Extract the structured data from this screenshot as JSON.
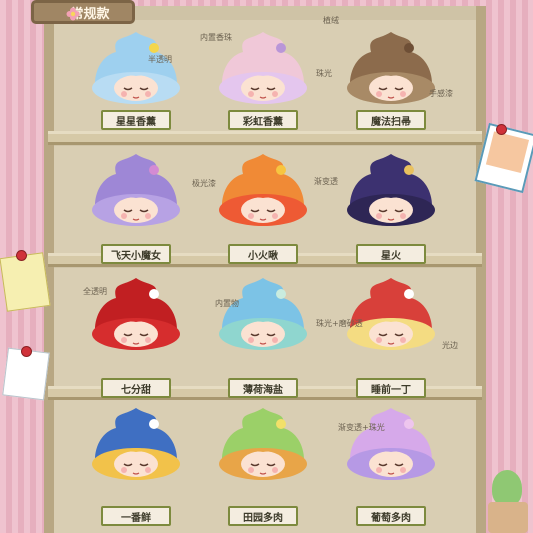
{
  "title": {
    "text": "常规款"
  },
  "items": [
    {
      "name": "星星香薰",
      "hair": "#b8dcf3",
      "body": "#9ed0ef",
      "accent": "#f4d64c"
    },
    {
      "name": "彩虹香薰",
      "hair": "#e4c6ee",
      "body": "#f0c8d8",
      "accent": "#b996d8"
    },
    {
      "name": "魔法扫帚",
      "hair": "#a88a66",
      "body": "#8c6b4c",
      "accent": "#6e4f36"
    },
    {
      "name": "飞天小魔女",
      "hair": "#b7a2e4",
      "body": "#9e87d6",
      "accent": "#d38bd3"
    },
    {
      "name": "小火啾",
      "hair": "#ee5a34",
      "body": "#f08a36",
      "accent": "#f7c540"
    },
    {
      "name": "星火",
      "hair": "#2e2655",
      "body": "#3c3170",
      "accent": "#e9c15e"
    },
    {
      "name": "七分甜",
      "hair": "#d62d2e",
      "body": "#c11f22",
      "accent": "#ffffff"
    },
    {
      "name": "薄荷海盐",
      "hair": "#8fd6cf",
      "body": "#7cc3e6",
      "accent": "#c9ecdf"
    },
    {
      "name": "睡前一丁",
      "hair": "#f4dc82",
      "body": "#d8403a",
      "accent": "#ffffff"
    },
    {
      "name": "一番鲜",
      "hair": "#f2c24a",
      "body": "#3f6fc2",
      "accent": "#ffffff"
    },
    {
      "name": "田园多肉",
      "hair": "#e8a548",
      "body": "#9bd068",
      "accent": "#f2e069"
    },
    {
      "name": "葡萄多肉",
      "hair": "#b699e5",
      "body": "#d6a9ea",
      "accent": "#eec5ee"
    }
  ],
  "notes": [
    "内置香珠",
    "半透明",
    "植绒",
    "珠光",
    "手感漆",
    "极光漆",
    "渐变透",
    "全透明",
    "内置物",
    "珠光+磨砂透",
    "光边",
    "渐变透+珠光"
  ],
  "colors": {
    "frame": "#cfc3a6",
    "label_border": "#7d8a3e",
    "background": "#e9b6c3"
  }
}
